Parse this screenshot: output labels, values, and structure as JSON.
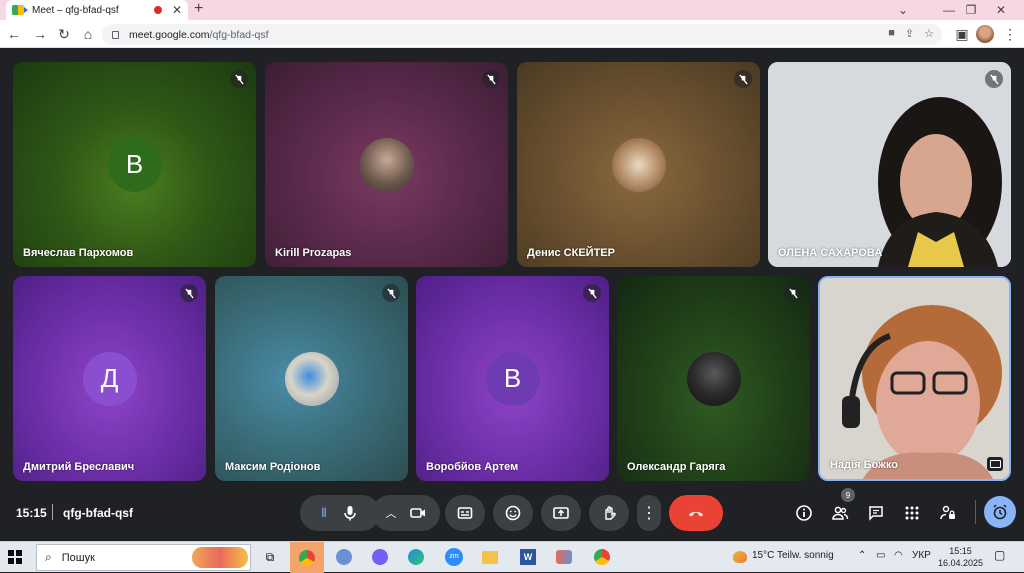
{
  "browser": {
    "tab_title": "Meet – qfg-bfad-qsf",
    "new_tab": "+",
    "url_host": "meet.google.com",
    "url_path": "/qfg-bfad-qsf",
    "window_controls": [
      "—",
      "❐",
      "✕"
    ]
  },
  "participants": [
    {
      "name": "Вячеслав Пархомов",
      "initial": "B",
      "avatar_color": "#2f6b1c",
      "muted": true
    },
    {
      "name": "Kirill Prozapas",
      "initial": "",
      "muted": true
    },
    {
      "name": "Денис СКЕЙТЕР",
      "initial": "",
      "muted": true
    },
    {
      "name": "ОЛЕНА САХАРОВА",
      "initial": "",
      "muted": true
    },
    {
      "name": "Дмитрий Бреславич",
      "initial": "Д",
      "avatar_color": "#8a4fd0",
      "muted": true
    },
    {
      "name": "Максим Родіонов",
      "initial": "",
      "muted": true
    },
    {
      "name": "Воробйов Артем",
      "initial": "В",
      "avatar_color": "#6f3bb0",
      "muted": true
    },
    {
      "name": "Олександр Гаряга",
      "initial": "",
      "muted": true
    },
    {
      "name": "Надія Божко",
      "initial": "",
      "muted": false
    }
  ],
  "meeting": {
    "time": "15:15",
    "code": "qfg-bfad-qsf",
    "people_count": "9"
  },
  "taskbar": {
    "search_placeholder": "Пошук",
    "weather": "15°C  Teilw. sonnig",
    "language": "УКР",
    "clock_time": "15:15",
    "clock_date": "16.04.2025"
  },
  "colors": {
    "end_call": "#ea4335",
    "accent": "#8ab4f8",
    "meet_bg": "#202124"
  }
}
